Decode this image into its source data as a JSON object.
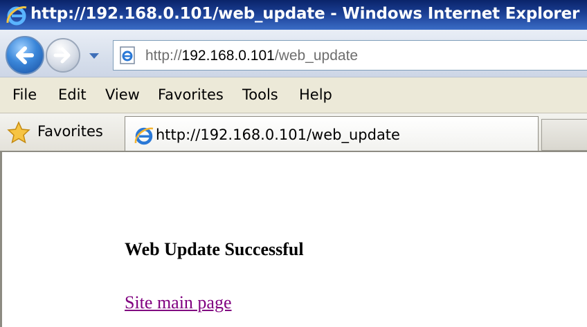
{
  "window": {
    "title": "http://192.168.0.101/web_update - Windows Internet Explorer"
  },
  "address_bar": {
    "url_protocol": "http://",
    "url_host": "192.168.0.101",
    "url_path": "/web_update"
  },
  "menu": {
    "items": [
      "File",
      "Edit",
      "View",
      "Favorites",
      "Tools",
      "Help"
    ]
  },
  "favorites_bar": {
    "favorites_label": "Favorites",
    "tab_title": "http://192.168.0.101/web_update"
  },
  "page": {
    "heading": "Web Update Successful",
    "link_text": "Site main page",
    "link_color": "#800080"
  },
  "icons": {
    "title_icon": "ie-logo-icon",
    "back": "back-arrow-icon",
    "forward": "forward-arrow-icon",
    "recent": "chevron-down-icon",
    "page": "ie-page-icon",
    "favorites": "star-icon",
    "tab": "ie-logo-icon"
  }
}
